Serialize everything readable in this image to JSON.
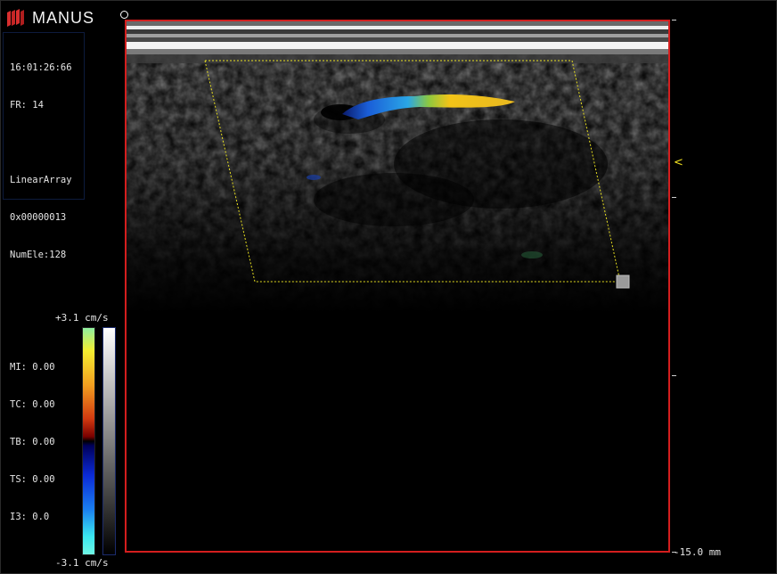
{
  "logo": {
    "text": "MANUS",
    "color": "#d82e2e"
  },
  "info": {
    "time": "16:01:26:66",
    "frame_rate": "FR: 14",
    "probe": "LinearArray",
    "probe_id": "0x00000013",
    "num_elements": "NumEle:128",
    "mi": "MI: 0.00",
    "tc": "TC: 0.00",
    "tb": "TB: 0.00",
    "ts": "TS: 0.00",
    "i3": "I3: 0.0"
  },
  "color_scale": {
    "max_label": "+3.1 cm/s",
    "min_label": "-3.1 cm/s"
  },
  "depth": {
    "max_label": "-15.0 mm",
    "focus_marker": "<"
  },
  "colors": {
    "image_border": "#d41e1e",
    "roi_outline": "#e8e020",
    "flow_positive": "#f2c418",
    "flow_negative": "#1a82e0"
  }
}
